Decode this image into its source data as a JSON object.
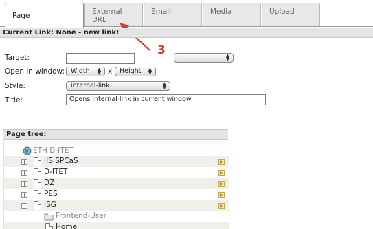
{
  "tabs": [
    {
      "label": "Page",
      "active": true
    },
    {
      "label": "External URL",
      "active": false
    },
    {
      "label": "Email",
      "active": false
    },
    {
      "label": "Media",
      "active": false
    },
    {
      "label": "Upload",
      "active": false
    }
  ],
  "annotation": {
    "number": "3",
    "color": "#d9382b"
  },
  "current_link": "Current Link: None - new link!",
  "form": {
    "target_label": "Target:",
    "target_value": "",
    "target_select_value": "",
    "window_label": "Open in window:",
    "width_value": "Width",
    "x_label": "x",
    "height_value": "Height",
    "style_label": "Style:",
    "style_value": "internal-link",
    "title_label": "Title:",
    "title_value": "Opens internal link in current window"
  },
  "page_tree": {
    "header": "Page tree:",
    "root": "ETH D-ITET",
    "items": [
      {
        "label": "IIS SPCaS",
        "expander": "+"
      },
      {
        "label": "D-ITET",
        "expander": "+"
      },
      {
        "label": "DZ",
        "expander": "+"
      },
      {
        "label": "PES",
        "expander": "+"
      },
      {
        "label": "ISG",
        "expander": "−"
      }
    ],
    "children": [
      {
        "label": "Frontend-User",
        "type": "folder"
      },
      {
        "label": "Home",
        "type": "page"
      }
    ]
  },
  "colors": {
    "accent_red": "#d9382b",
    "tree_link_red": "#c0392b"
  }
}
